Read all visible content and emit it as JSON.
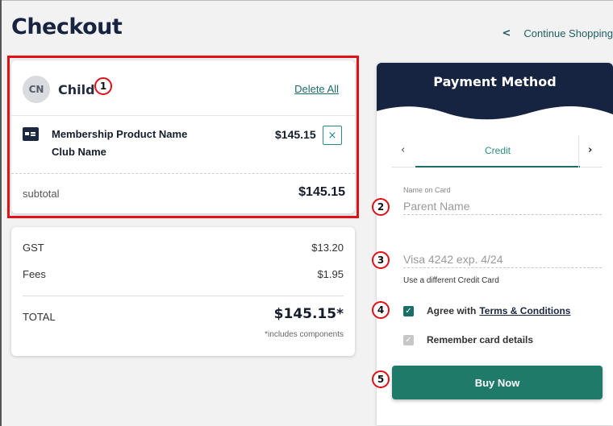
{
  "page": {
    "title": "Checkout",
    "continue_shopping": "Continue Shopping"
  },
  "cart": {
    "avatar_initials": "CN",
    "child_name": "Child",
    "delete_all": "Delete All",
    "items": [
      {
        "product_name": "Membership Product Name",
        "club_name": "Club Name",
        "price": "$145.15",
        "remove_symbol": "×"
      }
    ],
    "subtotal_label": "subtotal",
    "subtotal_value": "$145.15"
  },
  "totals": {
    "gst_label": "GST",
    "gst_value": "$13.20",
    "fees_label": "Fees",
    "fees_value": "$1.95",
    "total_label": "TOTAL",
    "total_value": "$145.15*",
    "includes_note": "*includes components"
  },
  "payment": {
    "title": "Payment Method",
    "tab_prev_symbol": "‹",
    "tab_active": "Credit",
    "tab_next_symbol": "›",
    "name_label": "Name on Card",
    "name_placeholder": "Parent Name",
    "card_placeholder": "Visa 4242 exp. 4/24",
    "use_different_card": "Use a different Credit Card",
    "agree_text": "Agree with",
    "terms_link": "Terms & Conditions",
    "agree_checked": true,
    "remember_text": "Remember card details",
    "remember_checked": true,
    "buy_button": "Buy Now"
  },
  "annotations": {
    "markers": [
      "1",
      "2",
      "3",
      "4",
      "5"
    ]
  },
  "colors": {
    "primary_navy": "#162341",
    "teal": "#1f7a6a",
    "highlight_red": "#e20f16"
  },
  "icons": {
    "back_chevron": "chevron-left-icon",
    "product": "membership-card-icon",
    "remove": "close-icon",
    "check": "checkmark-icon"
  }
}
